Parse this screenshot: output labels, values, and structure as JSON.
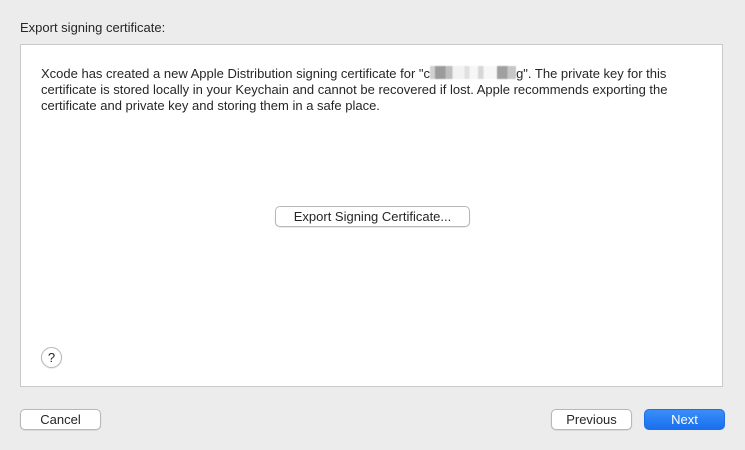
{
  "dialog": {
    "section_label": "Export signing certificate:",
    "message_part1": "Xcode has created a new Apple Distribution signing certificate for \"c",
    "message_redacted": "",
    "message_part2": "g\". The private key for this certificate is stored locally in your Keychain and cannot be recovered if lost. Apple recommends exporting the certificate and private key and storing them in a safe place.",
    "export_button_label": "Export Signing Certificate...",
    "help_button_label": "?"
  },
  "footer": {
    "cancel_label": "Cancel",
    "previous_label": "Previous",
    "next_label": "Next"
  },
  "colors": {
    "background": "#ececec",
    "panel": "#ffffff",
    "accent": "#1a6ff0"
  }
}
